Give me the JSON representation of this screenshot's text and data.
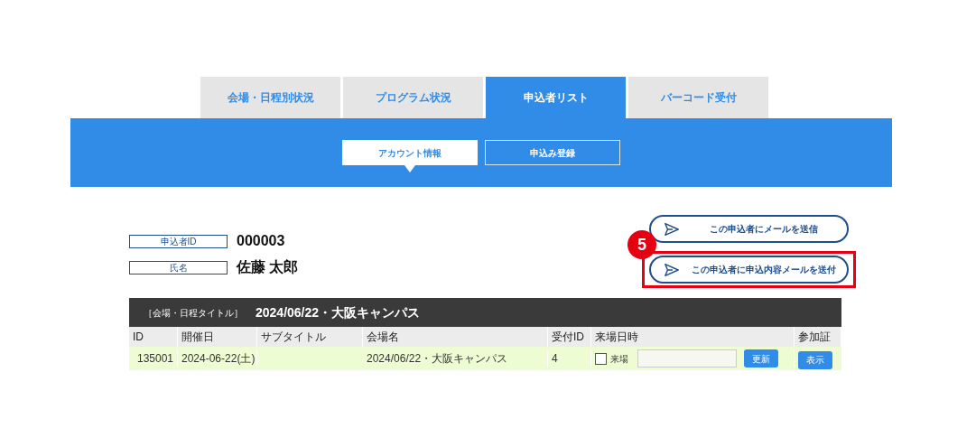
{
  "tabs": [
    {
      "label": "会場・日程別状況",
      "selected": false
    },
    {
      "label": "プログラム状況",
      "selected": false
    },
    {
      "label": "申込者リスト",
      "selected": true
    },
    {
      "label": "バーコード受付",
      "selected": false
    }
  ],
  "subtabs": [
    {
      "label": "アカウント情報",
      "selected": true
    },
    {
      "label": "申込み登録",
      "selected": false
    }
  ],
  "applicant": [
    {
      "label": "申込者ID",
      "value": "000003"
    },
    {
      "label": "氏名",
      "value": "佐藤 太郎"
    }
  ],
  "actions": [
    {
      "label": "この申込者にメールを送信",
      "highlighted": false
    },
    {
      "label": "この申込者に申込内容メールを送付",
      "highlighted": true
    }
  ],
  "callout": "5",
  "table": {
    "title_label": "［会場・日程タイトル］",
    "title": "2024/06/22・大阪キャンパス",
    "columns": [
      "ID",
      "開催日",
      "サブタイトル",
      "会場名",
      "受付ID",
      "来場日時",
      "参加証"
    ],
    "rows": [
      {
        "id": "135001",
        "date": "2024-06-22(土)",
        "subtitle": "",
        "venue": "2024/06/22・大阪キャンパス",
        "reception_id": "4",
        "visit_label": "来場",
        "visit_checked": false,
        "update_button": "更新",
        "pass_button": "表示"
      }
    ]
  }
}
